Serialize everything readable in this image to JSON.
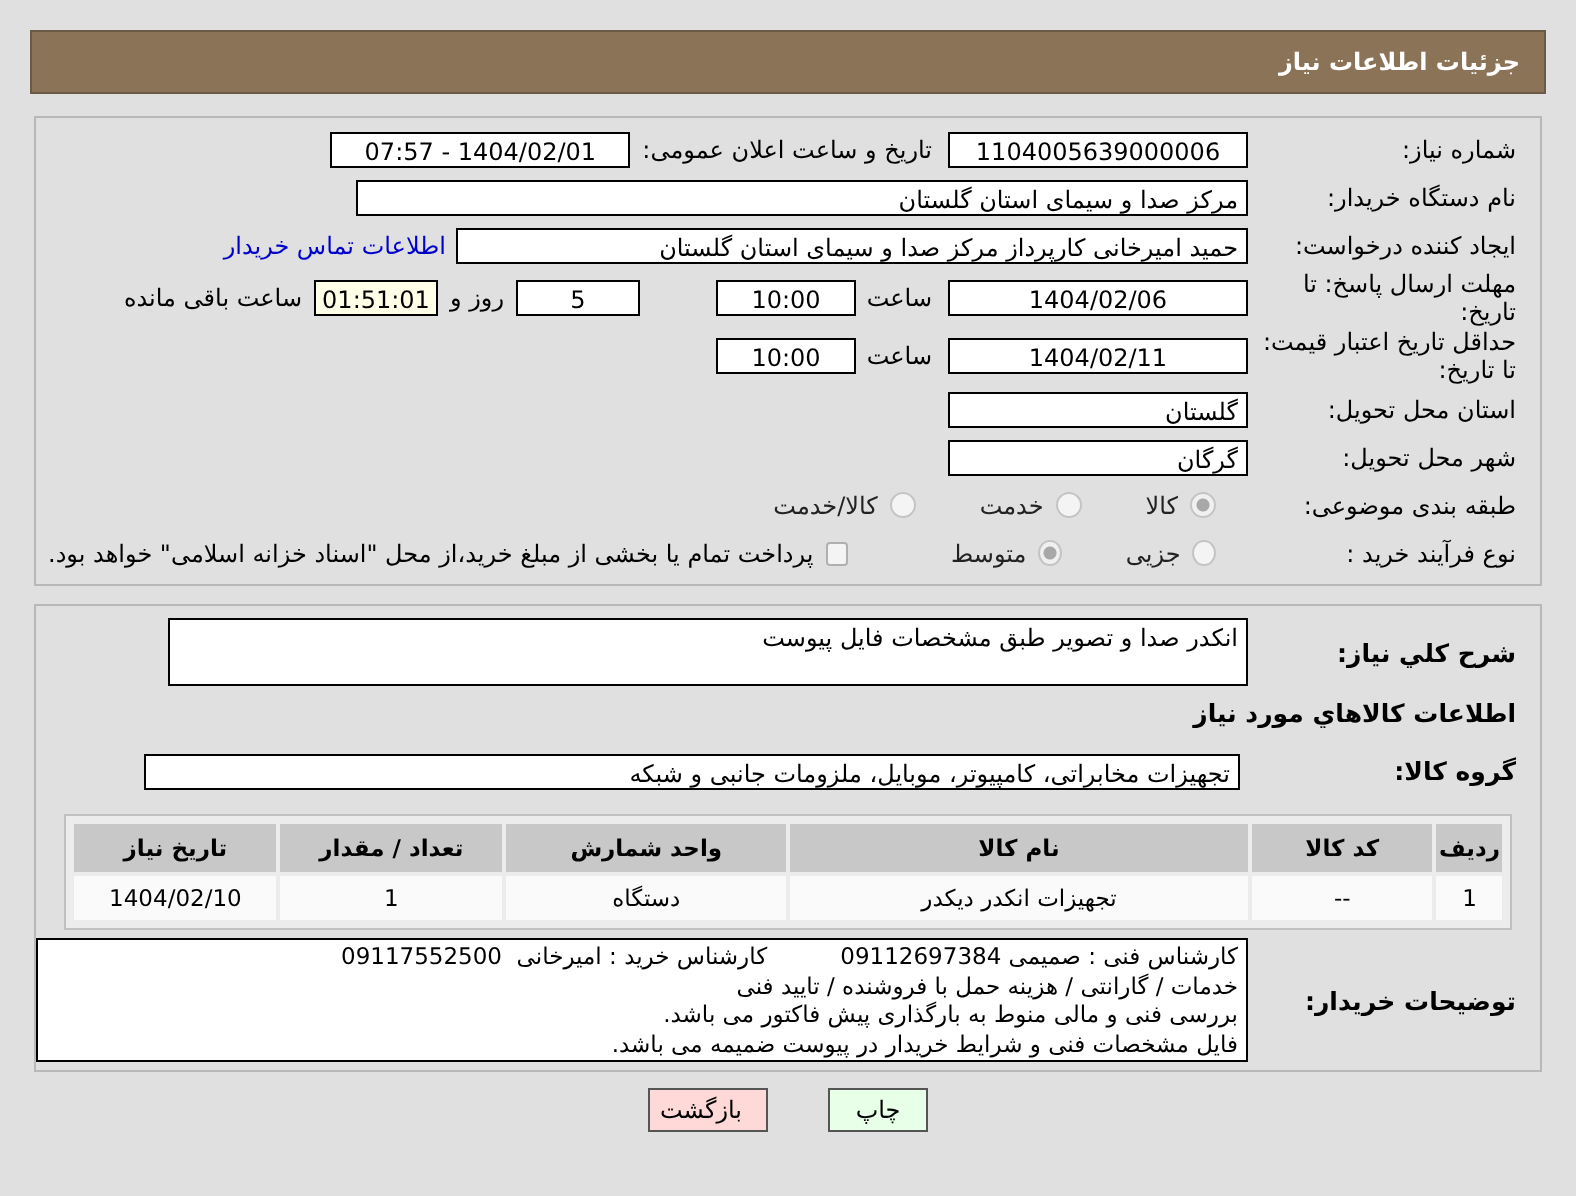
{
  "header": {
    "title": "جزئیات اطلاعات نیاز"
  },
  "need_number": {
    "label": "شماره نیاز:",
    "value": "1104005639000006"
  },
  "announce": {
    "label": "تاریخ و ساعت اعلان عمومی:",
    "value": "1404/02/01 - 07:57"
  },
  "buyer": {
    "label": "نام دستگاه خریدار:",
    "value": "مرکز صدا و سیمای استان گلستان"
  },
  "creator": {
    "label": "ایجاد کننده درخواست:",
    "value": "حمید امیرخانی کارپرداز مرکز صدا و سیمای استان گلستان",
    "link": "اطلاعات تماس خریدار"
  },
  "deadline": {
    "label": "مهلت ارسال پاسخ: تا تاریخ:",
    "date": "1404/02/06",
    "time_label": "ساعت",
    "time": "10:00",
    "days": "5",
    "days_label": "روز و",
    "remaining": "01:51:01",
    "remaining_label": "ساعت باقی مانده"
  },
  "validity": {
    "label": "حداقل تاریخ اعتبار قیمت: تا تاریخ:",
    "date": "1404/02/11",
    "time_label": "ساعت",
    "time": "10:00"
  },
  "province": {
    "label": "استان محل تحویل:",
    "value": "گلستان"
  },
  "city": {
    "label": "شهر محل تحویل:",
    "value": "گرگان"
  },
  "category": {
    "label": "طبقه بندی موضوعی:",
    "options": [
      {
        "label": "کالا",
        "selected": true
      },
      {
        "label": "خدمت",
        "selected": false
      },
      {
        "label": "کالا/خدمت",
        "selected": false
      }
    ]
  },
  "process": {
    "label": "نوع فرآیند خرید :",
    "options": [
      {
        "label": "جزیی",
        "selected": false
      },
      {
        "label": "متوسط",
        "selected": true
      }
    ],
    "payment": {
      "label": "پرداخت تمام یا بخشی از مبلغ خرید،از محل \"اسناد خزانه اسلامی\" خواهد بود.",
      "checked": false
    }
  },
  "description": {
    "label": "شرح کلي نیاز:",
    "value": "انکدر صدا و تصویر طبق مشخصات فایل پیوست"
  },
  "goods_heading": "اطلاعات کالاهاي مورد نیاز",
  "goods_group": {
    "label": "گروه کالا:",
    "value": "تجهیزات مخابراتی، کامپیوتر، موبایل، ملزومات جانبی و شبکه"
  },
  "table": {
    "columns": [
      "ردیف",
      "کد کالا",
      "نام کالا",
      "واحد شمارش",
      "تعداد / مقدار",
      "تاریخ نیاز"
    ],
    "rows": [
      [
        "1",
        "--",
        "تجهیزات انکدر دیکدر",
        "دستگاه",
        "1",
        "1404/02/10"
      ]
    ]
  },
  "notes": {
    "label": "توضیحات خریدار:",
    "lines": [
      "کارشناس فنی : صمیمی 09112697384          کارشناس خرید : امیرخانی  09117552500",
      "خدمات / گارانتی / هزینه حمل با فروشنده / تایید فنی",
      "بررسی فنی و مالی منوط به بارگذاری پیش فاکتور می باشد.",
      "فایل مشخصات فنی و شرایط خریدار در پیوست ضمیمه می باشد."
    ]
  },
  "buttons": [
    {
      "label": "چاپ",
      "kind": "print"
    },
    {
      "label": "بازگشت",
      "kind": "back"
    }
  ]
}
